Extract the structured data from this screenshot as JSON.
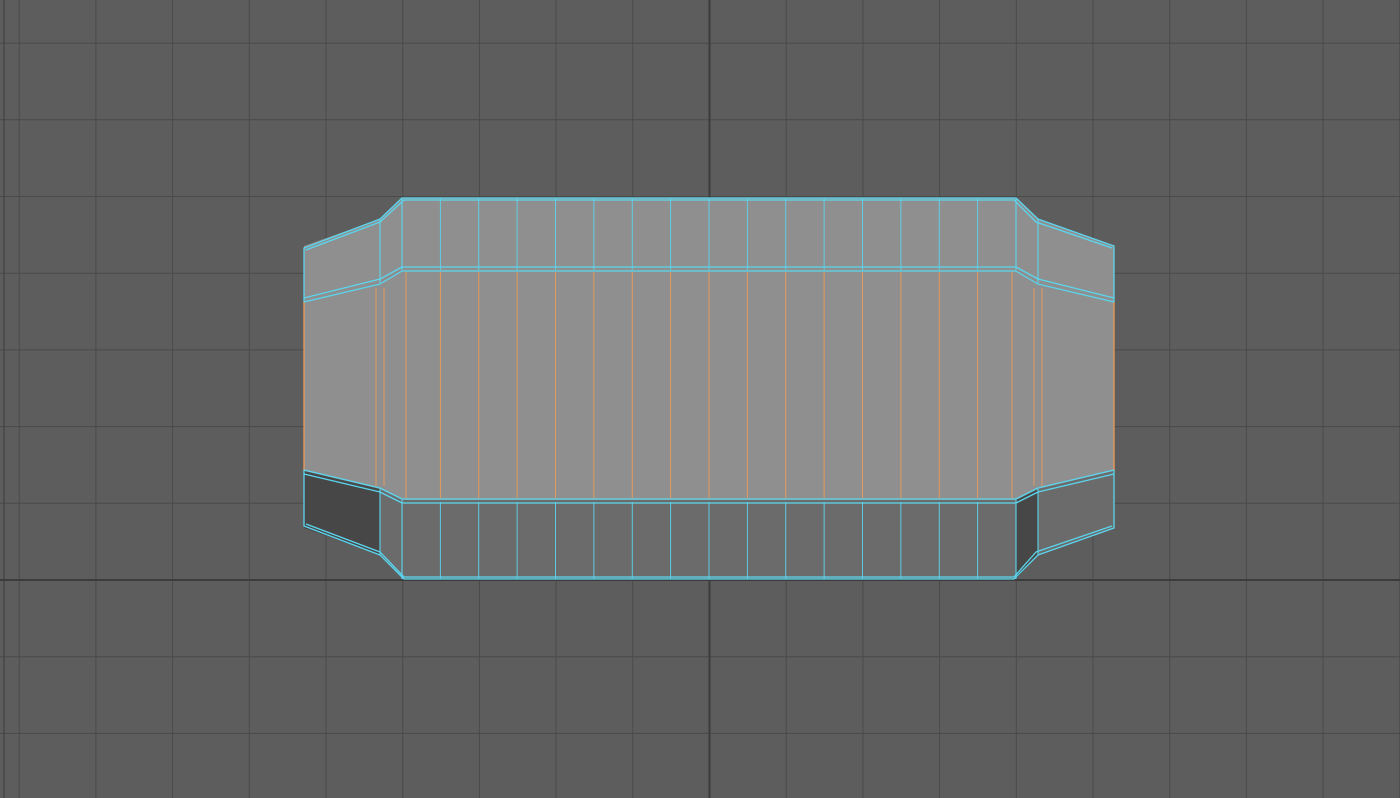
{
  "viewport": {
    "background": "#5d5d5d",
    "grid_color": "#4a4a4a",
    "axis_color": "#3c3c3c",
    "grid_visible": true
  },
  "mesh": {
    "type": "beveled cylinder (wireframe on shaded)",
    "selected": true,
    "selection_edge_color": "#5bd5ee",
    "selected_face_edge_color": "#ec9c57",
    "shade_light": "#8f8f8f",
    "shade_dark": "#474747",
    "shade_mid": "#6b6b6b",
    "body_segments_visible": 16
  }
}
